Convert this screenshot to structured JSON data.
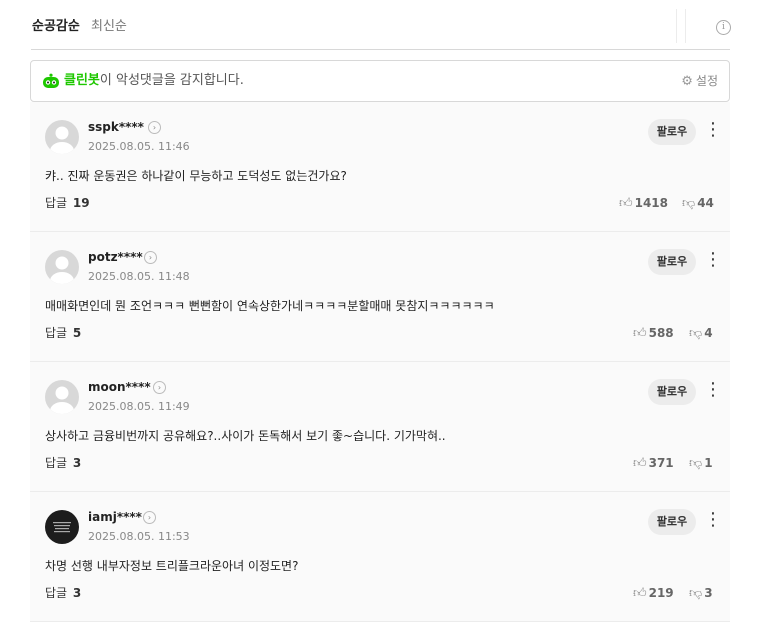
{
  "sort": {
    "tabs": [
      {
        "label": "순공감순"
      },
      {
        "label": "최신순"
      }
    ]
  },
  "info_icon": "i",
  "cleanbot": {
    "brand": "클린봇",
    "message": "이 악성댓글을 감지합니다.",
    "settings_label": "설정"
  },
  "follow_label": "팔로우",
  "replies_label": "답글",
  "comments": [
    {
      "nickname": "sspk****",
      "date": "2025.08.05. 11:46",
      "text": "캬.. 진짜 운동권은 하나같이 무능하고 도덕성도 없는건가요?",
      "replies": "19",
      "likes": "1418",
      "dislikes": "44",
      "avatar": "default"
    },
    {
      "nickname": "potz****",
      "date": "2025.08.05. 11:48",
      "text": "매매화면인데 뭔 조언ㅋㅋㅋ 뻔뻔함이 연속상한가네ㅋㅋㅋㅋ분할매매 못참지ㅋㅋㅋㅋㅋㅋ",
      "replies": "5",
      "likes": "588",
      "dislikes": "4",
      "avatar": "default"
    },
    {
      "nickname": "moon****",
      "date": "2025.08.05. 11:49",
      "text": "상사하고 금융비번까지 공유해요?..사이가 돈독해서 보기 좋~습니다. 기가막혀..",
      "replies": "3",
      "likes": "371",
      "dislikes": "1",
      "avatar": "default"
    },
    {
      "nickname": "iamj****",
      "date": "2025.08.05. 11:53",
      "text": "차명 선행 내부자정보 트리플크라운아녀 이정도면?",
      "replies": "3",
      "likes": "219",
      "dislikes": "3",
      "avatar": "custom-dark"
    }
  ]
}
